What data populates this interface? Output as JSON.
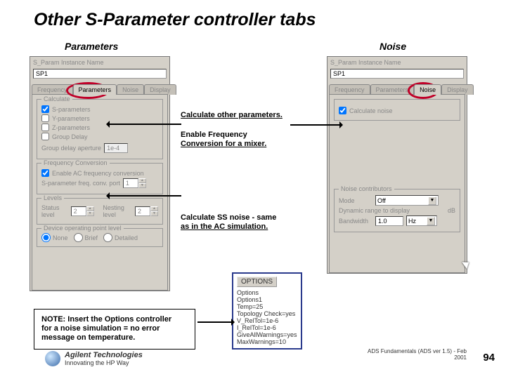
{
  "title": "Other S-Parameter controller tabs",
  "sections": {
    "left": "Parameters",
    "right": "Noise"
  },
  "left": {
    "hdr": "S_Param Instance Name",
    "instance": "SP1",
    "tabs": {
      "freq": "Frequency",
      "params": "Parameters",
      "noise": "Noise",
      "display": "Display"
    },
    "calc": {
      "title": "Calculate",
      "sparams": "S-parameters",
      "yparams": "Y-parameters",
      "zparams": "Z-parameters",
      "gdelay": "Group Delay",
      "aperture_lbl": "Group delay aperture",
      "aperture_val": "1e-4"
    },
    "fc": {
      "title": "Frequency Conversion",
      "enable": "Enable AC frequency conversion",
      "port_lbl": "S-parameter freq. conv. port",
      "port_val": "1"
    },
    "lv": {
      "title": "Levels",
      "status": "Status level",
      "status_val": "2",
      "nest": "Nesting level",
      "nest_val": "2"
    },
    "dop": {
      "title": "Device operating point level",
      "none": "None",
      "brief": "Brief",
      "detailed": "Detailed"
    }
  },
  "right": {
    "hdr": "S_Param Instance Name",
    "instance": "SP1",
    "tabs": {
      "freq": "Frequency",
      "params": "Parameters",
      "noise": "Noise",
      "display": "Display"
    },
    "calc": {
      "title": "",
      "cb": "Calculate noise"
    },
    "nc": {
      "title": "Noise contributors",
      "mode_lbl": "Mode",
      "mode_val": "Off",
      "dr_lbl": "Dynamic range to display",
      "dr_unit": "dB",
      "bw_lbl": "Bandwidth",
      "bw_val": "1.0",
      "bw_unit": "Hz"
    }
  },
  "callouts": {
    "c1": "Calculate other parameters.",
    "c2a": "Enable Frequency",
    "c2b": "Conversion for a mixer.",
    "c3a": "Calculate SS noise - same",
    "c3b": "as in the AC simulation."
  },
  "note": {
    "l1": "NOTE: Insert the Options controller",
    "l2": "for a noise simulation = no error",
    "l3": "message on temperature."
  },
  "options": {
    "hdr": "OPTIONS",
    "l1": "Options",
    "l2": "Options1",
    "l3": "Temp=25",
    "l4": "Topology Check=yes",
    "l5": "V_RelTol=1e-6",
    "l6": "I_RelTol=1e-6",
    "l7": "GiveAllWarnings=yes",
    "l8": "MaxWarnings=10"
  },
  "brand": {
    "name": "Agilent Technologies",
    "tag": "Innovating the HP Way"
  },
  "footer": "ADS Fundamentals (ADS ver 1.5) - Feb 2001",
  "page": "94"
}
